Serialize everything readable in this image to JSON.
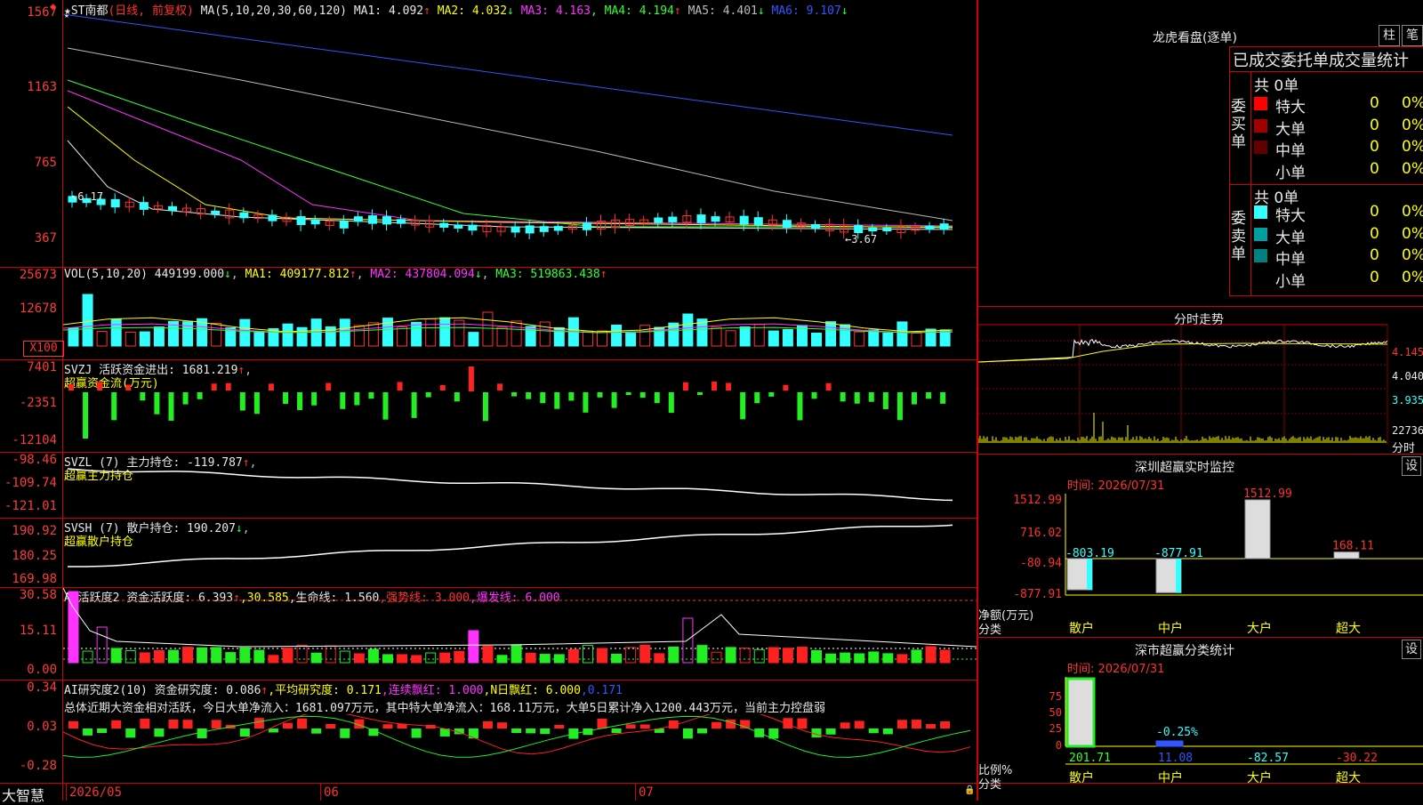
{
  "app_name": "大智慧",
  "stock": {
    "name": "★ST南都",
    "mode": "(日线, 前复权)",
    "ma_title": "MA(5,10,20,30,60,120)",
    "ma": [
      {
        "label": "MA1:",
        "value": "4.092",
        "arrow": "↑",
        "color": "#e8e8e8"
      },
      {
        "label": "MA2:",
        "value": "4.032",
        "arrow": "↓",
        "color": "#ffff00"
      },
      {
        "label": "MA3:",
        "value": "4.163",
        "arrow": ",",
        "color": "#ff33ff"
      },
      {
        "label": "MA4:",
        "value": "4.194",
        "arrow": "↑",
        "color": "#33ff33"
      },
      {
        "label": "MA5:",
        "value": "4.401",
        "arrow": "↓",
        "color": "#bbbbbb"
      },
      {
        "label": "MA6:",
        "value": "9.107",
        "arrow": "↓",
        "color": "#3355ff"
      }
    ],
    "price_axis": [
      "1567",
      "1163",
      "765",
      "367"
    ],
    "high_label": "6.17",
    "low_label": "3.67"
  },
  "volume": {
    "title": "VOL(5,10,20)",
    "value": "449199.000",
    "value_arrow": "↓",
    "ma1": "MA1: 409177.812",
    "ma1_arrow": "↑",
    "ma2": "MA2: 437804.094",
    "ma2_arrow": "↓",
    "ma3": "MA3: 519863.438",
    "ma3_arrow": "↑",
    "axis": [
      "25673",
      "12678"
    ],
    "unit": "X100"
  },
  "svzj": {
    "title": "SVZJ",
    "desc": "活跃资金进出: 1681.219",
    "arrow": "↑",
    "sub": "超赢资金流(万元)",
    "axis": [
      "7401",
      "-2351",
      "-12104"
    ]
  },
  "svzl": {
    "title": "SVZL (7)",
    "desc": "主力持仓: -119.787",
    "arrow": "↑",
    "sub": "超赢主力持仓",
    "axis": [
      "-98.46",
      "-109.74",
      "-121.01"
    ]
  },
  "svsh": {
    "title": "SVSH (7)",
    "desc": "散户持仓: 190.207",
    "arrow": "↓",
    "sub": "超赢散户持仓",
    "axis": [
      "190.92",
      "180.25",
      "169.98"
    ]
  },
  "ai_active": {
    "title": "AI活跃度2",
    "desc": "资金活跃度: 6.393",
    "arrow": "↑",
    "v2": ",30.585",
    "life": ",生命线: 1.560",
    "strong": ",强势线: 3.000",
    "burst": ",爆发线: 6.000",
    "axis": [
      "30.58",
      "15.11",
      "0.00"
    ]
  },
  "ai_research": {
    "title": "AI研究度2(10)",
    "desc": "资金研究度: 0.086",
    "arrow": "↑",
    "avg": ",平均研究度: 0.171",
    "red": ",连续飘红: 1.000",
    "nred": ",N日飘红: 6.000",
    "v5": ",0.171",
    "summary": "总体近期大资金相对活跃，今日大单净流入：1681.097万元，其中特大单净流入：168.11万元，大单5日累计净入1200.443万元，当前主力控盘弱",
    "axis": [
      "0.34",
      "0.03",
      "-0.28"
    ]
  },
  "dates": [
    "2026/05",
    "06",
    "07"
  ],
  "dragon": {
    "title": "龙虎看盘(逐单)",
    "btn1": "柱",
    "btn2": "笔",
    "sub": "已成交委托单成交量统计",
    "buy_side": "委买单",
    "sell_side": "委卖单",
    "buy_total": "共 0单",
    "sell_total": "共 0单",
    "buy_rows": [
      {
        "label": "特大",
        "count": "0",
        "pct": "0%",
        "color": "#ff0000"
      },
      {
        "label": "大单",
        "count": "0",
        "pct": "0%",
        "color": "#a00000"
      },
      {
        "label": "中单",
        "count": "0",
        "pct": "0%",
        "color": "#600000"
      },
      {
        "label": "小单",
        "count": "0",
        "pct": "0%",
        "color": ""
      }
    ],
    "sell_rows": [
      {
        "label": "特大",
        "count": "0",
        "pct": "0%",
        "color": "#33ffff"
      },
      {
        "label": "大单",
        "count": "0",
        "pct": "0%",
        "color": "#00a0a0"
      },
      {
        "label": "中单",
        "count": "0",
        "pct": "0%",
        "color": "#008080"
      },
      {
        "label": "小单",
        "count": "0",
        "pct": "0%",
        "color": ""
      }
    ]
  },
  "intraday": {
    "title": "分时走势",
    "price_axis": [
      "4.145",
      "4.040",
      "3.935"
    ],
    "vol_axis": "22736",
    "vol_label": "分时"
  },
  "sz_monitor": {
    "title": "深圳超赢实时监控",
    "settings": "设",
    "time": "时间: 2026/07/31",
    "axis": [
      "1512.99",
      "716.02",
      "-80.94",
      "-877.91"
    ],
    "ylabel": "净额(万元)",
    "xlabel": "分类",
    "categories": [
      "散户",
      "中户",
      "大户",
      "超大"
    ],
    "values": [
      -803.19,
      -877.91,
      1512.99,
      168.11
    ],
    "value_labels": [
      "-803.19",
      "-877.91",
      "1512.99",
      "168.11"
    ]
  },
  "sz_class": {
    "title": "深市超赢分类统计",
    "settings": "设",
    "time": "时间: 2026/07/31",
    "axis": [
      "75",
      "50",
      "25",
      "0"
    ],
    "ylabel": "比例%",
    "xlabel": "分类",
    "categories": [
      "散户",
      "中户",
      "大户",
      "超大"
    ],
    "bar_values": [
      100,
      -0.25,
      0,
      0
    ],
    "bar_label": "-0.25%",
    "values": [
      "201.71",
      "11.08",
      "-82.57",
      "-30.22"
    ]
  },
  "colors": {
    "up": "#ff3030",
    "down": "#33ffff",
    "frame": "#d00000",
    "bg": "#000000"
  }
}
